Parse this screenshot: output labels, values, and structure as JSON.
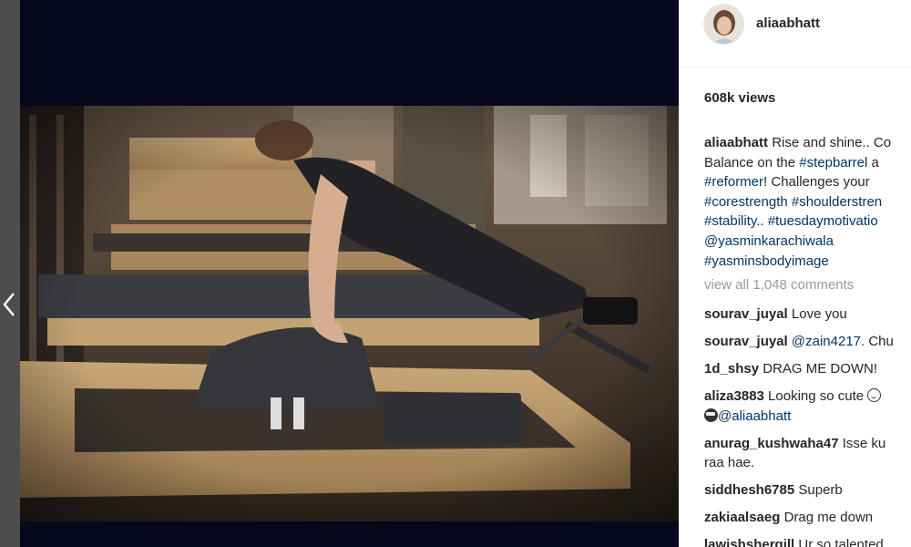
{
  "post": {
    "username": "aliaabhatt",
    "views": "608k views",
    "caption": {
      "username": "aliaabhatt",
      "lines": [
        [
          "Rise and shine.. Co"
        ],
        [
          "Balance on the ",
          "#stepbarrel",
          " a"
        ],
        [
          "#reformer",
          "! Challenges your"
        ],
        [
          "#corestrength",
          " ",
          "#shoulderstren"
        ],
        [
          "#stability",
          ".. ",
          "#tuesdaymotivatio"
        ],
        [
          "@yasminkarachiwala"
        ],
        [
          "#yasminsbodyimage"
        ]
      ]
    },
    "view_all_comments": "view all 1,048 comments"
  },
  "comments": [
    {
      "user": "sourav_juyal",
      "text": " Love you"
    },
    {
      "user": "sourav_juyal",
      "mention": "@zain4217",
      "text": ". Chu"
    },
    {
      "user": "1d_shsy",
      "text": " DRAG ME DOWN!"
    },
    {
      "user": "aliza3883",
      "text": " Looking so cute ",
      "mention2": "@aliaabhatt"
    },
    {
      "user": "anurag_kushwaha47",
      "text": " Isse ku",
      "text2": "raa hae."
    },
    {
      "user": "siddhesh6785",
      "text": " Superb"
    },
    {
      "user": "zakiaalsaeg",
      "text": " Drag me down"
    },
    {
      "user": "lawishshergill",
      "text": " Ur so talented"
    }
  ],
  "icons": {
    "prev": "chevron-left-icon",
    "emoji_smile": "smiling-face-emoji",
    "emoji_cool": "sunglasses-face-emoji"
  },
  "colors": {
    "text": "#262626",
    "hashtag": "#003569",
    "muted": "#999999",
    "media_bg": "#07071c"
  }
}
